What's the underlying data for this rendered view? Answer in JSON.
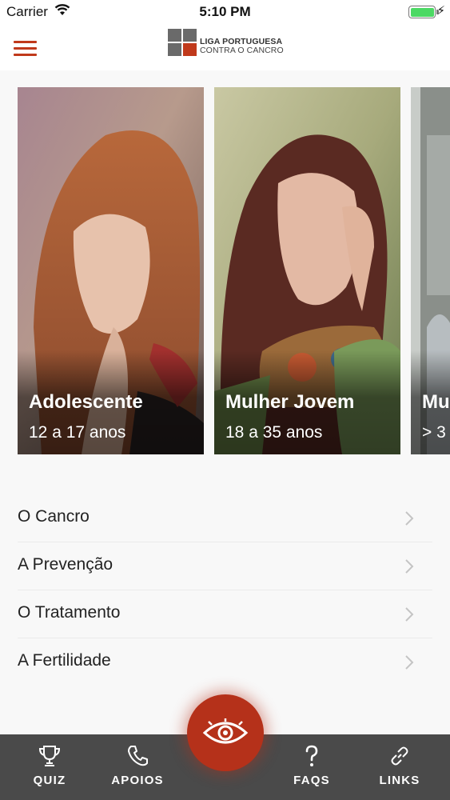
{
  "status_bar": {
    "carrier": "Carrier",
    "time": "5:10 PM",
    "battery_level": 1.0,
    "battery_color": "#4cd964"
  },
  "header": {
    "menu_icon": "hamburger-icon",
    "logo_line1": "LIGA PORTUGUESA",
    "logo_line2": "CONTRA O CANCRO",
    "accent_color": "#c0391b"
  },
  "profiles": [
    {
      "title": "Adolescente",
      "subtitle": "12 a 17 anos"
    },
    {
      "title": "Mulher Jovem",
      "subtitle": "18 a 35 anos"
    },
    {
      "title": "Mu",
      "subtitle": "> 3"
    }
  ],
  "menu": [
    {
      "label": "O Cancro"
    },
    {
      "label": "A Prevenção"
    },
    {
      "label": "O Tratamento"
    },
    {
      "label": "A Fertilidade"
    }
  ],
  "tabbar": {
    "background": "#4a4a4a",
    "tabs": [
      {
        "label": "QUIZ",
        "icon": "trophy-icon"
      },
      {
        "label": "APOIOS",
        "icon": "phone-icon"
      },
      {
        "label": "FAQS",
        "icon": "question-icon"
      },
      {
        "label": "LINKS",
        "icon": "link-icon"
      }
    ],
    "center_button_icon": "eye-icon",
    "center_button_color": "#b5311a"
  }
}
